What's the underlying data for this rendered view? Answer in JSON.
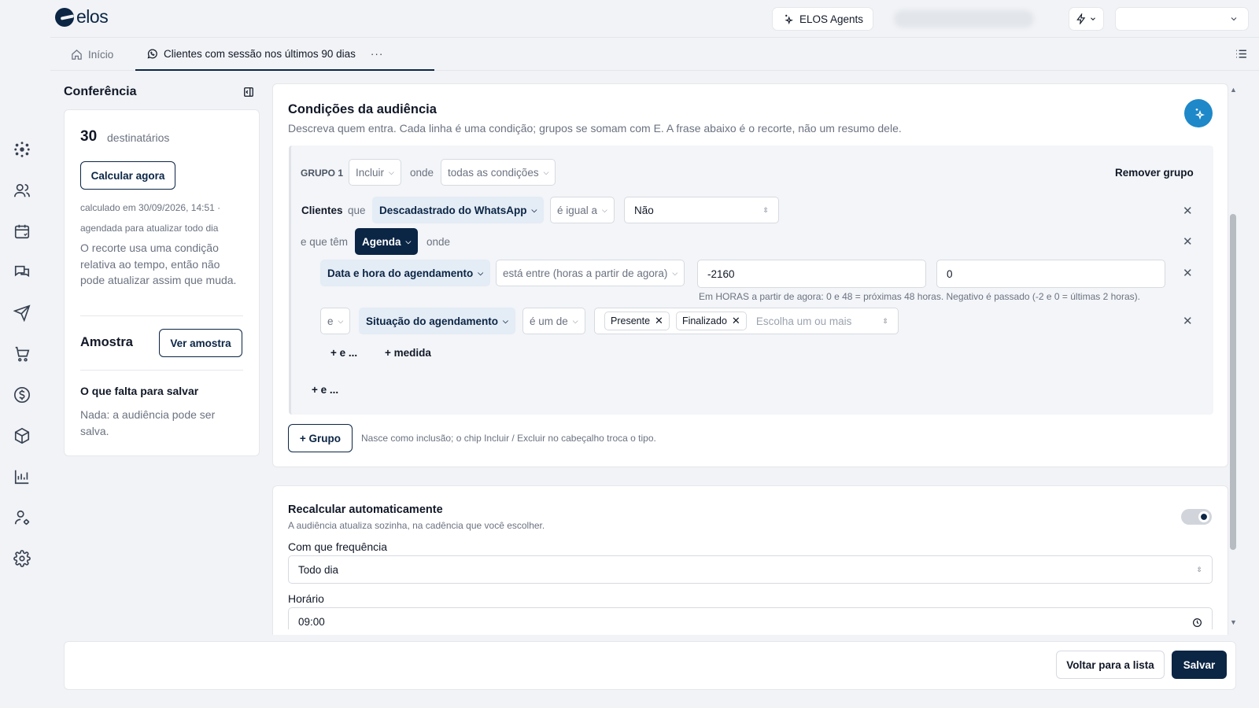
{
  "app": {
    "logo_text": "elos"
  },
  "topbar": {
    "agents_label": "ELOS Agents"
  },
  "tabs": {
    "home_label": "Início",
    "active_label": "Clientes com sessão nos últimos 90 dias",
    "more_label": "···"
  },
  "conference": {
    "title": "Conferência",
    "count": "30",
    "count_label": "destinatários",
    "calc_button": "Calcular agora",
    "calc_meta": "calculado em 30/09/2026, 14:51 · agendada para atualizar todo dia",
    "calc_desc": "O recorte usa uma condição relativa ao tempo, então não pode atualizar assim que muda.",
    "sample_title": "Amostra",
    "sample_button": "Ver amostra",
    "missing_title": "O que falta para salvar",
    "missing_desc": "Nada: a audiência pode ser salva."
  },
  "conditions": {
    "title": "Condições da audiência",
    "subtitle": "Descreva quem entra. Cada linha é uma condição; grupos se somam com E. A frase abaixo é o recorte, não um resumo dele.",
    "group": {
      "label": "GRUPO 1",
      "mode": "Incluir",
      "where_label": "onde",
      "match": "todas as condições",
      "remove_label": "Remover grupo",
      "row1": {
        "entity": "Clientes",
        "que": "que",
        "field": "Descadastrado do WhatsApp",
        "operator": "é igual a",
        "value": "Não"
      },
      "row2": {
        "prefix": "e que têm",
        "entity": "Agenda",
        "where": "onde"
      },
      "row3": {
        "field": "Data e hora do agendamento",
        "operator": "está entre (horas a partir de agora)",
        "value_from": "-2160",
        "value_to": "0",
        "hint": "Em HORAS a partir de agora: 0 e 48 = próximas 48 horas. Negativo é passado (-2 e 0 = últimas 2 horas)."
      },
      "row4": {
        "connector": "e",
        "field": "Situação do agendamento",
        "operator": "é um de",
        "tags": [
          "Presente",
          "Finalizado"
        ],
        "placeholder": "Escolha um ou mais"
      },
      "add_and_inner": "+ e ...",
      "add_measure": "+ medida",
      "add_and_outer": "+ e ..."
    },
    "add_group_button": "+ Grupo",
    "add_group_hint": "Nasce como inclusão; o chip Incluir / Excluir no cabeçalho troca o tipo."
  },
  "recalc": {
    "title": "Recalcular automaticamente",
    "subtitle": "A audiência atualiza sozinha, na cadência que você escolher.",
    "toggle_on": true,
    "frequency_label": "Com que frequência",
    "frequency_value": "Todo dia",
    "time_label": "Horário",
    "time_value": "09:00"
  },
  "footer": {
    "back_button": "Voltar para a lista",
    "save_button": "Salvar"
  },
  "colors": {
    "brand": "#0b2545",
    "accent": "#1e88c9",
    "chip_blue_bg": "#e4ecf5",
    "background": "#f1f3f6"
  }
}
